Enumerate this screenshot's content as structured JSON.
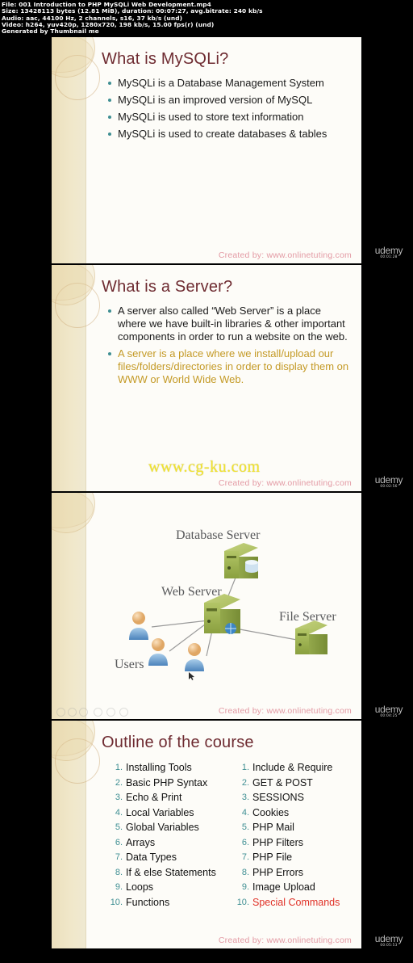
{
  "metadata": {
    "file_line": "File:  001 Introduction to PHP  MySQLi Web Development.mp4",
    "size_line_label": "Size:",
    "size_line": "Size:  13428113 bytes (12.81 MiB),  duration: 00:07:27,  avg.bitrate: 240 kb/s",
    "audio_line": "Audio: aac, 44100 Hz, 2 channels, s16, 37 kb/s (und)",
    "video_line": "Video: h264, yuv420p, 1280x720, 198 kb/s, 15.00 fps(r) (und)",
    "generated_line": "Generated by Thumbnail me"
  },
  "slides": [
    {
      "title": "What is MySQLi?",
      "bullets": [
        "MySQLi is a Database Management System",
        "MySQLi is an improved version of MySQL",
        "MySQLi is used to store text information",
        "MySQLi is used to create databases & tables"
      ],
      "credit": "Created by: www.onlinetuting.com",
      "timestamp": "00:01:28"
    },
    {
      "title": "What is a Server?",
      "bullets": [
        "A server also called “Web Server” is a place where we have built-in libraries & other important components in order to run a website on the web.",
        "A server is a place where we install/upload our files/folders/directories in order to display them on WWW or World Wide Web."
      ],
      "watermark": "www.cg-ku.com",
      "credit": "Created by: www.onlinetuting.com",
      "timestamp": "00:02:56"
    },
    {
      "diagram": {
        "nodes": [
          {
            "id": "database-server",
            "label": "Database Server"
          },
          {
            "id": "web-server",
            "label": "Web Server"
          },
          {
            "id": "file-server",
            "label": "File Server"
          },
          {
            "id": "users",
            "label": "Users"
          }
        ]
      },
      "credit": "Created by: www.onlinetuting.com",
      "timestamp": "00:04:25"
    },
    {
      "title": "Outline of the course",
      "column_left": [
        "Installing Tools",
        "Basic PHP Syntax",
        "Echo & Print",
        "Local Variables",
        "Global Variables",
        "Arrays",
        "Data Types",
        "If & else Statements",
        "Loops",
        "Functions"
      ],
      "column_right": [
        "Include & Require",
        "GET & POST",
        "SESSIONS",
        "Cookies",
        "PHP Mail",
        "PHP Filters",
        "PHP File",
        "PHP Errors",
        "Image Upload",
        "Special Commands"
      ],
      "highlight_right_index": 9,
      "credit": "Created by: www.onlinetuting.com",
      "timestamp": "00:05:53"
    }
  ],
  "watermark_brand": "udemy",
  "colors": {
    "title": "#6e2b31",
    "bullet_dot": "#3f8f93",
    "gold_text": "#c49a26",
    "credit": "#e39aa4",
    "highlight": "#e03127",
    "sidebar": "#ece0bd"
  }
}
